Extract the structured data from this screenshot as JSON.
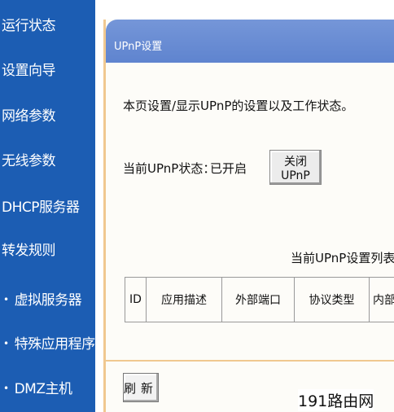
{
  "sidebar": {
    "items": [
      {
        "label": "运行状态"
      },
      {
        "label": "设置向导"
      },
      {
        "label": "网络参数"
      },
      {
        "label": "无线参数"
      },
      {
        "label": "DHCP服务器"
      },
      {
        "label": "转发规则"
      }
    ],
    "subitems": [
      {
        "bullet": "•",
        "label": "虚拟服务器"
      },
      {
        "bullet": "•",
        "label": "特殊应用程序"
      },
      {
        "bullet": "•",
        "label": "DMZ主机"
      }
    ]
  },
  "panel": {
    "title": "UPnP设置",
    "description": "本页设置/显示UPnP的设置以及工作状态。",
    "status_label": "当前UPnP状态：",
    "status_value": "已开启",
    "close_button": "关闭UPnP",
    "list_title": "当前UPnP设置列表",
    "table_headers": [
      "ID",
      "应用描述",
      "外部端口",
      "协议类型",
      "内部"
    ],
    "refresh_button": "刷新"
  },
  "watermark": "191路由网"
}
